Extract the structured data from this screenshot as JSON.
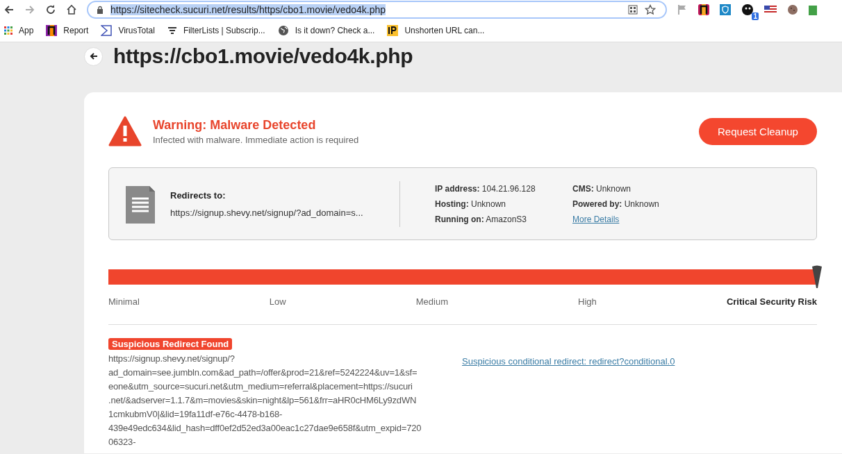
{
  "browser": {
    "url": "https://sitecheck.sucuri.net/results/https/cbo1.movie/vedo4k.php",
    "url_selected": true,
    "extension_badge": "1",
    "bookmarks": [
      {
        "kind": "apps",
        "label": "App"
      },
      {
        "kind": "report",
        "label": "Report"
      },
      {
        "kind": "virustotal",
        "label": "VirusTotal"
      },
      {
        "kind": "filter",
        "label": "FilterLists | Subscrip..."
      },
      {
        "kind": "globe",
        "label": "Is it down? Check a..."
      },
      {
        "kind": "ip",
        "label": "Unshorten URL can..."
      }
    ]
  },
  "page": {
    "title": "https://cbo1.movie/vedo4k.php",
    "warning": {
      "title": "Warning: Malware Detected",
      "subtitle": "Infected with malware. Immediate action is required"
    },
    "cleanup_button": "Request Cleanup",
    "info": {
      "redirect_label": "Redirects to:",
      "redirect_url": "https://signup.shevy.net/signup/?ad_domain=s...",
      "fields": [
        {
          "label": "IP address:",
          "value": "104.21.96.128"
        },
        {
          "label": "CMS:",
          "value": "Unknown"
        },
        {
          "label": "Hosting:",
          "value": "Unknown"
        },
        {
          "label": "Powered by:",
          "value": "Unknown"
        },
        {
          "label": "Running on:",
          "value": "AmazonS3"
        }
      ],
      "more_link": "More Details"
    },
    "risk": {
      "level": 1,
      "levels": [
        {
          "label": "Minimal",
          "selected": false
        },
        {
          "label": "Low",
          "selected": false
        },
        {
          "label": "Medium",
          "selected": false
        },
        {
          "label": "High",
          "selected": false
        },
        {
          "label": "Critical Security Risk",
          "selected": true
        }
      ]
    },
    "finding": {
      "badge": "Suspicious Redirect Found",
      "url_lines": [
        "https://signup.shevy.net/signup/?",
        "ad_domain=see.jumbln.com&ad_path=/offer&prod=21&ref=5242224&uv=1&sf=",
        "eone&utm_source=sucuri.net&utm_medium=referral&placement=https://sucuri",
        ".net/&adserver=1.1.7&m=movies&skin=night&lp=561&frr=aHR0cHM6Ly9zdWN",
        "1cmkubmV0|&lid=19fa11df-e76c-4478-b168-",
        "439e49edc634&lid_hash=dff0ef2d52ed3a00eac1c27dae9e658f&utm_expid=720",
        "06323-"
      ],
      "detail_link": "Suspicious conditional redirect: redirect?conditional.0"
    }
  }
}
